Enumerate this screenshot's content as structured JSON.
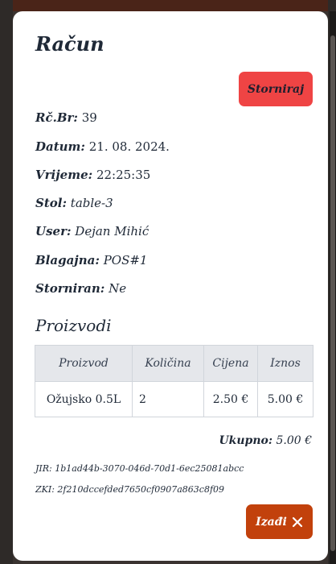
{
  "modal": {
    "title": "Račun",
    "void_button": "Storniraj",
    "fields": [
      {
        "label": "Rč.Br:",
        "value": "39"
      },
      {
        "label": "Datum:",
        "value": "21. 08. 2024."
      },
      {
        "label": "Vrijeme:",
        "value": "22:25:35"
      },
      {
        "label": "Stol:",
        "value": "table-3"
      },
      {
        "label": "User:",
        "value": "Dejan Mihić"
      },
      {
        "label": "Blagajna:",
        "value": "POS#1"
      },
      {
        "label": "Storniran:",
        "value": "Ne"
      }
    ],
    "products_title": "Proizvodi",
    "table": {
      "headers": [
        "Proizvod",
        "Količina",
        "Cijena",
        "Iznos"
      ],
      "rows": [
        [
          "Ožujsko 0.5L",
          "2",
          "2.50 €",
          "5.00 €"
        ]
      ]
    },
    "total_label": "Ukupno:",
    "total_value": "5.00 €",
    "jir_label": "JIR:",
    "jir_value": "1b1ad44b-3070-046d-70d1-6ec25081abcc",
    "zki_label": "ZKI:",
    "zki_value": "2f210dccefded7650cf0907a863c8f09",
    "exit_button": "Izađi"
  },
  "colors": {
    "void_button": "#ef4444",
    "exit_button": "#c2410c",
    "table_header": "#e5e7eb"
  }
}
